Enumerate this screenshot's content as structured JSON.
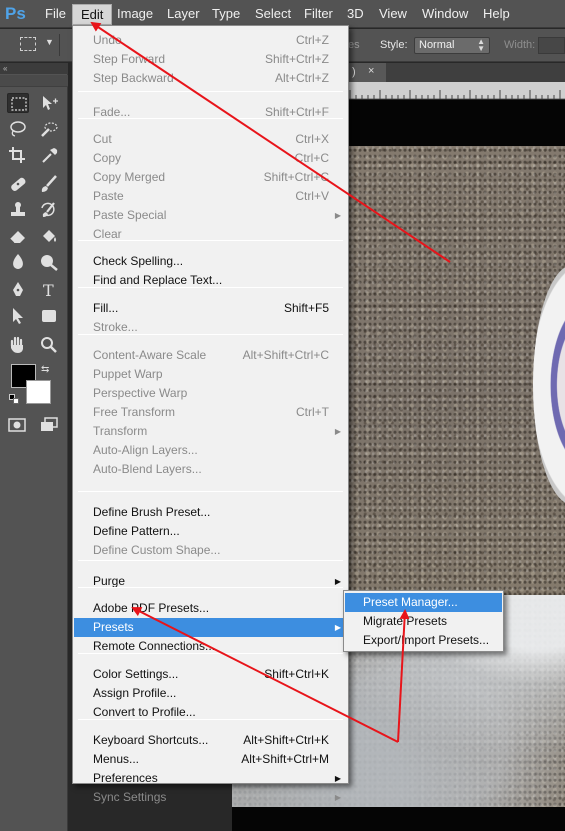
{
  "app": {
    "logo": "Ps",
    "menu_bar": [
      "File",
      "Edit",
      "Image",
      "Layer",
      "Type",
      "Select",
      "Filter",
      "3D",
      "View",
      "Window",
      "Help"
    ]
  },
  "options_bar": {
    "style_label": "Style:",
    "style_value": "Normal",
    "width_label": "Width:",
    "partial_text": "es"
  },
  "document": {
    "tab_partial": ")",
    "tab_close": "×"
  },
  "edit_menu": {
    "items": [
      {
        "label": "Undo",
        "shortcut": "Ctrl+Z",
        "disabled": true
      },
      {
        "label": "Step Forward",
        "shortcut": "Shift+Ctrl+Z",
        "disabled": true
      },
      {
        "label": "Step Backward",
        "shortcut": "Alt+Ctrl+Z",
        "disabled": true
      },
      {
        "label": "Fade...",
        "shortcut": "Shift+Ctrl+F",
        "disabled": true
      },
      {
        "label": "Cut",
        "shortcut": "Ctrl+X",
        "disabled": true
      },
      {
        "label": "Copy",
        "shortcut": "Ctrl+C",
        "disabled": true
      },
      {
        "label": "Copy Merged",
        "shortcut": "Shift+Ctrl+C",
        "disabled": true
      },
      {
        "label": "Paste",
        "shortcut": "Ctrl+V",
        "disabled": true
      },
      {
        "label": "Paste Special",
        "shortcut": "",
        "disabled": true,
        "submenu": true
      },
      {
        "label": "Clear",
        "shortcut": "",
        "disabled": true
      },
      {
        "label": "Check Spelling...",
        "shortcut": "",
        "disabled": false
      },
      {
        "label": "Find and Replace Text...",
        "shortcut": "",
        "disabled": false
      },
      {
        "label": "Fill...",
        "shortcut": "Shift+F5",
        "disabled": false
      },
      {
        "label": "Stroke...",
        "shortcut": "",
        "disabled": true
      },
      {
        "label": "Content-Aware Scale",
        "shortcut": "Alt+Shift+Ctrl+C",
        "disabled": true
      },
      {
        "label": "Puppet Warp",
        "shortcut": "",
        "disabled": true
      },
      {
        "label": "Perspective Warp",
        "shortcut": "",
        "disabled": true
      },
      {
        "label": "Free Transform",
        "shortcut": "Ctrl+T",
        "disabled": true
      },
      {
        "label": "Transform",
        "shortcut": "",
        "disabled": true,
        "submenu": true
      },
      {
        "label": "Auto-Align Layers...",
        "shortcut": "",
        "disabled": true
      },
      {
        "label": "Auto-Blend Layers...",
        "shortcut": "",
        "disabled": true
      },
      {
        "label": "Define Brush Preset...",
        "shortcut": "",
        "disabled": false
      },
      {
        "label": "Define Pattern...",
        "shortcut": "",
        "disabled": false
      },
      {
        "label": "Define Custom Shape...",
        "shortcut": "",
        "disabled": true
      },
      {
        "label": "Purge",
        "shortcut": "",
        "disabled": false,
        "submenu": true
      },
      {
        "label": "Adobe PDF Presets...",
        "shortcut": "",
        "disabled": false
      },
      {
        "label": "Presets",
        "shortcut": "",
        "disabled": false,
        "submenu": true,
        "highlighted": true
      },
      {
        "label": "Remote Connections...",
        "shortcut": "",
        "disabled": false
      },
      {
        "label": "Color Settings...",
        "shortcut": "Shift+Ctrl+K",
        "disabled": false
      },
      {
        "label": "Assign Profile...",
        "shortcut": "",
        "disabled": false
      },
      {
        "label": "Convert to Profile...",
        "shortcut": "",
        "disabled": false
      },
      {
        "label": "Keyboard Shortcuts...",
        "shortcut": "Alt+Shift+Ctrl+K",
        "disabled": false
      },
      {
        "label": "Menus...",
        "shortcut": "Alt+Shift+Ctrl+M",
        "disabled": false
      },
      {
        "label": "Preferences",
        "shortcut": "",
        "disabled": false,
        "submenu": true
      },
      {
        "label": "Sync Settings",
        "shortcut": "",
        "disabled": true,
        "submenu": true
      }
    ]
  },
  "presets_submenu": {
    "items": [
      {
        "label": "Preset Manager...",
        "highlighted": true
      },
      {
        "label": "Migrate Presets",
        "highlighted": false
      },
      {
        "label": "Export/Import Presets...",
        "highlighted": false
      }
    ]
  },
  "colors": {
    "menu_highlight": "#3d8ee0",
    "annotation_arrow": "#e8141a",
    "foreground_swatch": "#000000",
    "background_swatch": "#ffffff"
  },
  "tools": [
    "rectangular-marquee-icon",
    "move-icon",
    "lasso-icon",
    "quick-selection-icon",
    "crop-icon",
    "eyedropper-icon",
    "healing-brush-icon",
    "brush-icon",
    "clone-stamp-icon",
    "history-brush-icon",
    "eraser-icon",
    "paint-bucket-icon",
    "blur-icon",
    "dodge-icon",
    "pen-icon",
    "type-icon",
    "path-selection-icon",
    "rectangle-shape-icon",
    "hand-icon",
    "zoom-icon",
    "quick-mask-icon",
    "screen-mode-icon"
  ]
}
